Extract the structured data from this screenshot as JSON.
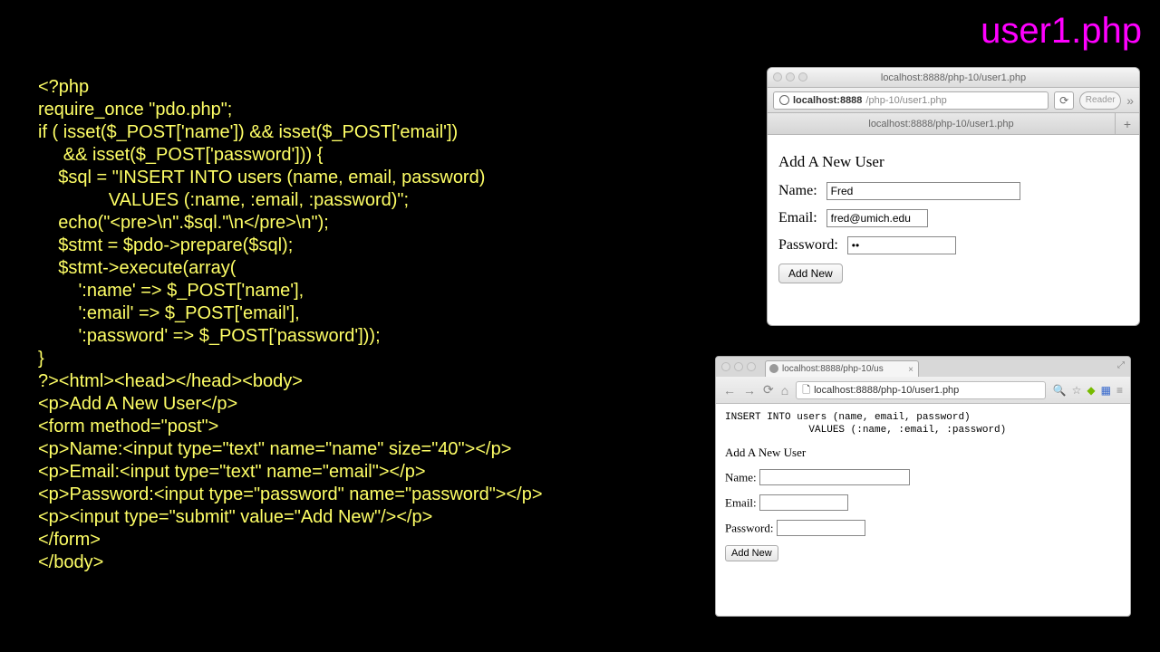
{
  "title": "user1.php",
  "code": "<?php\nrequire_once \"pdo.php\";\nif ( isset($_POST['name']) && isset($_POST['email'])\n     && isset($_POST['password'])) {\n    $sql = \"INSERT INTO users (name, email, password)\n              VALUES (:name, :email, :password)\";\n    echo(\"<pre>\\n\".$sql.\"\\n</pre>\\n\");\n    $stmt = $pdo->prepare($sql);\n    $stmt->execute(array(\n        ':name' => $_POST['name'],\n        ':email' => $_POST['email'],\n        ':password' => $_POST['password']));\n}\n?><html><head></head><body>\n<p>Add A New User</p>\n<form method=\"post\">\n<p>Name:<input type=\"text\" name=\"name\" size=\"40\"></p>\n<p>Email:<input type=\"text\" name=\"email\"></p>\n<p>Password:<input type=\"password\" name=\"password\"></p>\n<p><input type=\"submit\" value=\"Add New\"/></p>\n</form>\n</body>",
  "safari": {
    "window_title": "localhost:8888/php-10/user1.php",
    "url_host": "localhost:8888",
    "url_path": "/php-10/user1.php",
    "reader": "Reader",
    "tab_title": "localhost:8888/php-10/user1.php",
    "heading": "Add A New User",
    "name_label": "Name:",
    "name_value": "Fred",
    "email_label": "Email:",
    "email_value": "fred@umich.edu",
    "password_label": "Password:",
    "password_value": "••",
    "submit": "Add New"
  },
  "chrome": {
    "tab_title": "localhost:8888/php-10/us",
    "url": "localhost:8888/php-10/user1.php",
    "sql_echo": "INSERT INTO users (name, email, password)\n              VALUES (:name, :email, :password)",
    "heading": "Add A New User",
    "name_label": "Name:",
    "email_label": "Email:",
    "password_label": "Password:",
    "submit": "Add New"
  }
}
